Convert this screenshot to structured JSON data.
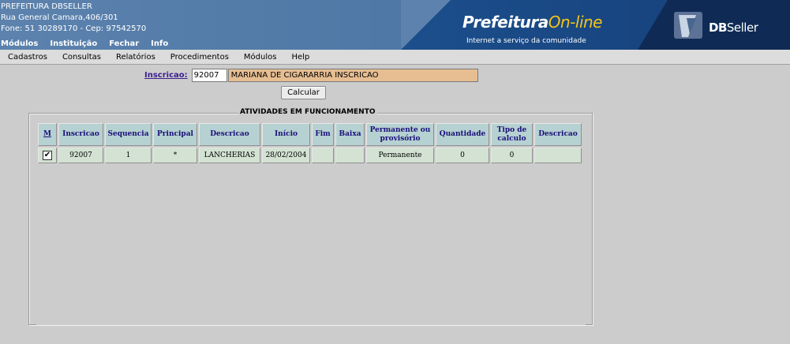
{
  "header": {
    "line1": "PREFEITURA DBSELLER",
    "line2": "Rua General Camara,406/301",
    "line3": "Fone: 51 30289170  -  Cep: 97542570",
    "top_menu": [
      "Módulos",
      "Instituição",
      "Fechar",
      "Info"
    ],
    "logo_main": "Prefeitura",
    "logo_accent": "On-line",
    "logo_tagline": "Internet a serviço da comunidade",
    "brand_db": "DB",
    "brand_seller": "Seller"
  },
  "menubar": [
    "Cadastros",
    "Consultas",
    "Relatórios",
    "Procedimentos",
    "Módulos",
    "Help"
  ],
  "form": {
    "inscricao_label": "Inscricao:",
    "inscricao_value": "92007",
    "name_value": "MARIANA DE CIGARARRIA INSCRICAO",
    "calc_label": "Calcular"
  },
  "section": {
    "title": "ATIVIDADES EM FUNCIONAMENTO",
    "columns": [
      "M",
      "Inscricao",
      "Sequencia",
      "Principal",
      "Descricao",
      "Início",
      "Fim",
      "Baixa",
      "Permanente ou provisório",
      "Quantidade",
      "Tipo de calculo",
      "Descricao"
    ],
    "rows": [
      {
        "checked": "✔",
        "inscricao": "92007",
        "sequencia": "1",
        "principal": "*",
        "descricao": "LANCHERIAS",
        "inicio": "28/02/2004",
        "fim": "",
        "baixa": "",
        "permanente": "Permanente",
        "quantidade": "0",
        "tipo": "0",
        "descricao2": ""
      }
    ]
  },
  "colors": {
    "header_bg": "#5c82ad",
    "table_head": "#b6d1d1",
    "table_cell": "#d3e2d3",
    "name_bg": "#e6be92"
  }
}
